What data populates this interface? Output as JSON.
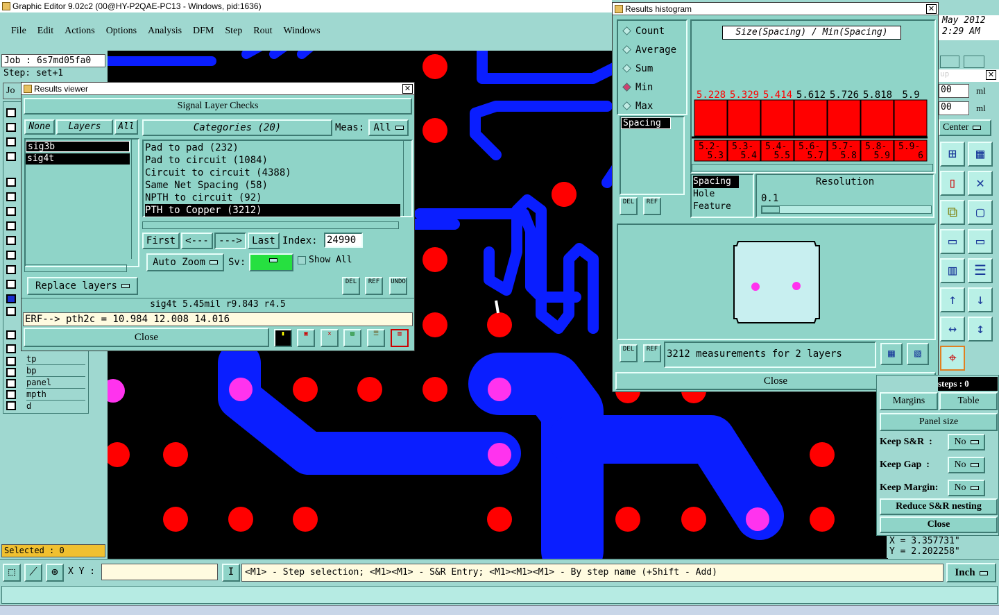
{
  "main": {
    "title": "Graphic Editor 9.02c2 (00@HY-P2QAE-PC13 - Windows, pid:1636)",
    "menu": [
      "File",
      "Edit",
      "Actions",
      "Options",
      "Analysis",
      "DFM",
      "Step",
      "Rout",
      "Windows"
    ],
    "date": "May 2012",
    "time": "2:29 AM"
  },
  "info": {
    "job": "Job : 6s7md05fa0",
    "step": "Step: set+1",
    "jo": "Jo",
    "selected": "Selected : 0"
  },
  "layers_list": [
    "tp",
    "bp",
    "panel",
    "mpth",
    "d"
  ],
  "status": {
    "xy_label": "X Y :",
    "xy_value": "",
    "hint": "<M1> - Step selection; <M1><M1> - S&R Entry; <M1><M1><M1> - By step name (+Shift - Add)",
    "unit": "Inch",
    "coord_x": "X = 3.357731\"",
    "coord_y": "Y = 2.202258\""
  },
  "results_viewer": {
    "title": "Results viewer",
    "header": "Signal Layer Checks",
    "none": "None",
    "layers": "Layers",
    "all": "All",
    "categories": "Categories (20)",
    "meas_label": "Meas:",
    "meas_value": "All",
    "layer_items": [
      "sig3b",
      "sig4t"
    ],
    "cat_items": [
      "Pad to pad (232)",
      "Pad to circuit (1084)",
      "Circuit to circuit (4388)",
      "Same Net Spacing (58)",
      "NPTH to circuit (92)",
      "PTH to Copper (3212)"
    ],
    "first": "First",
    "prev": "<---",
    "next": "--->",
    "last": "Last",
    "index_label": "Index:",
    "index_value": "24990",
    "auto_zoom": "Auto Zoom",
    "sv_label": "Sv:",
    "show_all": "Show All",
    "replace_layers": "Replace layers",
    "del": "DEL",
    "ref": "REF",
    "undo": "UNDO",
    "info_line": "sig4t 5.45mil  r9.843  r4.5",
    "erf_line": "ERF--> pth2c = 10.984 12.008 14.016",
    "close": "Close"
  },
  "histogram": {
    "title": "Results histogram",
    "stats": [
      "Count",
      "Average",
      "Sum",
      "Min",
      "Max"
    ],
    "selected_stat": "Min",
    "metric_items": [
      "Spacing"
    ],
    "chart_title": "Size(Spacing) / Min(Spacing)",
    "bar_values": [
      "5.228",
      "5.329",
      "5.414",
      "5.612",
      "5.726",
      "5.818",
      "5.9"
    ],
    "bins": [
      "5.2-5.3",
      "5.3-5.4",
      "5.4-5.5",
      "5.6-5.7",
      "5.7-5.8",
      "5.8-5.9",
      "5.9-6"
    ],
    "by_items": [
      "Spacing",
      "Hole",
      "Feature"
    ],
    "resolution_label": "Resolution",
    "resolution_value": "0.1",
    "measure_text": "3212 measurements for 2 layers",
    "del": "DEL",
    "ref": "REF",
    "close": "Close"
  },
  "right_panel": {
    "v1": "00",
    "u1": "ml",
    "v2": "00",
    "u2": "ml",
    "center": "Center",
    "steps": "steps : 0",
    "margins": "Margins",
    "table": "Table",
    "panel_size": "Panel size",
    "keep_sr": "Keep S&R  :",
    "keep_gap": "Keep Gap  :",
    "keep_margin": "Keep Margin:",
    "no": "No",
    "reduce": "Reduce S&R nesting",
    "close": "Close"
  },
  "chart_data": {
    "type": "bar",
    "title": "Size(Spacing) / Min(Spacing)",
    "categories": [
      "5.2-5.3",
      "5.3-5.4",
      "5.4-5.5",
      "5.6-5.7",
      "5.7-5.8",
      "5.8-5.9",
      "5.9-6"
    ],
    "values": [
      5.228,
      5.329,
      5.414,
      5.612,
      5.726,
      5.818,
      5.9
    ],
    "colors": {
      "bar": "#ff0000",
      "selected_label": "#ff0000"
    }
  },
  "colors": {
    "bg": "#9fd8d0",
    "canvas": "#000000",
    "trace": "#0a1eff",
    "pad": "#ff0000",
    "via": "#ff33ee"
  }
}
